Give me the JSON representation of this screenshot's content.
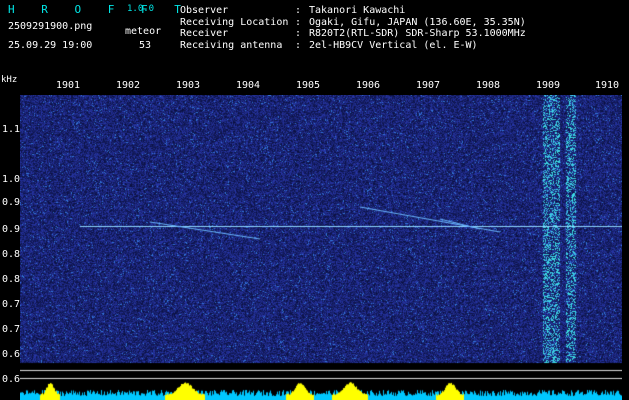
{
  "header": {
    "app_title": "H R O F F T",
    "version": "1.0.0",
    "filename": "2509291900.png",
    "datetime": "25.09.29 19:00",
    "mode": "meteor",
    "count": "53"
  },
  "info": [
    {
      "label": "Observer",
      "value": "Takanori Kawachi"
    },
    {
      "label": "Receiving Location",
      "value": "Ogaki, Gifu, JAPAN (136.60E, 35.35N)"
    },
    {
      "label": "Receiver",
      "value": "R820T2(RTL-SDR) SDR-Sharp 53.1000MHz"
    },
    {
      "label": "Receiving antenna",
      "value": "2el-HB9CV Vertical (el. E-W)"
    }
  ],
  "axis": {
    "unit": "kHz",
    "x_ticks": [
      "1901",
      "1902",
      "1903",
      "1904",
      "1905",
      "1906",
      "1907",
      "1908",
      "1909",
      "1910"
    ],
    "y_ticks": [
      "1.1",
      "1.0",
      "0.95",
      "0.9",
      "0.85",
      "0.8",
      "0.75",
      "0.7",
      "0.65",
      "0.6"
    ]
  },
  "colors": {
    "background": "#000000",
    "noise_base": "#101a7a",
    "carrier": "#8fd9ff",
    "activity_bar": "#ffff00",
    "floor_bar": "#00c8ff",
    "label_cyan": "#00e6e6"
  }
}
